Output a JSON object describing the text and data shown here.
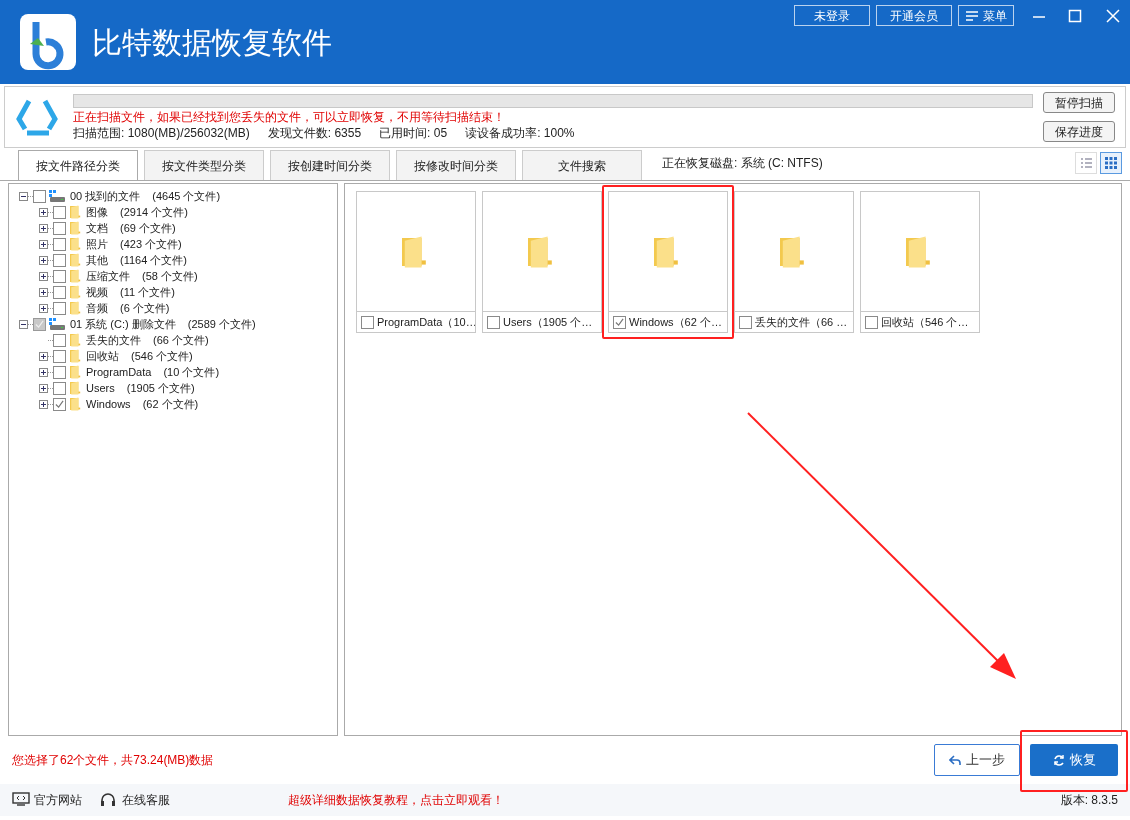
{
  "window": {
    "title": "比特数据恢复软件",
    "buttons": [
      {
        "kind": "text",
        "label": "未登录"
      },
      {
        "kind": "text",
        "label": "开通会员"
      },
      {
        "kind": "menu",
        "label": "菜单"
      }
    ]
  },
  "scan": {
    "level": 0,
    "message": "正在扫描文件，如果已经找到您丢失的文件，可以立即恢复，不用等待扫描结束！",
    "stats": [
      "扫描范围: 1080(MB)/256032(MB)",
      "发现文件数: 6355",
      "已用时间: 05",
      "读设备成功率: 100%"
    ],
    "buttons": [
      "暂停扫描",
      "保存进度"
    ]
  },
  "tabs": [
    {
      "label": "按文件路径分类",
      "selected": true
    },
    {
      "label": "按文件类型分类",
      "selected": false
    },
    {
      "label": "按创建时间分类",
      "selected": false
    },
    {
      "label": "按修改时间分类",
      "selected": false
    },
    {
      "label": "文件搜索",
      "selected": false
    }
  ],
  "disk_label": "正在恢复磁盘: 系统 (C: NTFS)",
  "view_modes": [
    {
      "kind": "list",
      "selected": false
    },
    {
      "kind": "grid",
      "selected": true
    }
  ],
  "tree": [
    {
      "label": "00 找到的文件",
      "count": "(4645 个文件)",
      "checked": false,
      "partial": false,
      "expanded": true,
      "children": [
        {
          "label": "图像",
          "count": "(2914 个文件)",
          "checked": false,
          "partial": false,
          "expanded": false
        },
        {
          "label": "文档",
          "count": "(69 个文件)",
          "checked": false,
          "partial": false,
          "expanded": false
        },
        {
          "label": "照片",
          "count": "(423 个文件)",
          "checked": false,
          "partial": false,
          "expanded": false
        },
        {
          "label": "其他",
          "count": "(1164 个文件)",
          "checked": false,
          "partial": false,
          "expanded": false
        },
        {
          "label": "压缩文件",
          "count": "(58 个文件)",
          "checked": false,
          "partial": false,
          "expanded": false
        },
        {
          "label": "视频",
          "count": "(11 个文件)",
          "checked": false,
          "partial": false,
          "expanded": false
        },
        {
          "label": "音频",
          "count": "(6 个文件)",
          "checked": false,
          "partial": false,
          "expanded": false
        }
      ]
    },
    {
      "label": "01 系统 (C:) 删除文件",
      "count": "(2589 个文件)",
      "checked": true,
      "partial": true,
      "expanded": true,
      "children": [
        {
          "label": "丢失的文件",
          "count": "(66 个文件)",
          "checked": false
        },
        {
          "label": "回收站",
          "count": "(546 个文件)",
          "checked": false,
          "partial": false,
          "expanded": false
        },
        {
          "label": "ProgramData",
          "count": "(10 个文件)",
          "checked": false,
          "partial": false,
          "expanded": false
        },
        {
          "label": "Users",
          "count": "(1905 个文件)",
          "checked": false,
          "partial": false,
          "expanded": false
        },
        {
          "label": "Windows",
          "count": "(62 个文件)",
          "checked": true,
          "expanded": false
        }
      ]
    }
  ],
  "tiles": [
    {
      "label": "ProgramData（10…",
      "checked": false,
      "highlighted": false
    },
    {
      "label": "Users（1905 个…",
      "checked": false,
      "highlighted": false
    },
    {
      "label": "Windows（62 个…",
      "checked": true,
      "highlighted": true
    },
    {
      "label": "丢失的文件（66 …",
      "checked": false,
      "highlighted": false
    },
    {
      "label": "回收站（546 个…",
      "checked": false,
      "highlighted": false
    }
  ],
  "selection_summary": "您选择了62个文件，共73.24(MB)数据",
  "actions": [
    {
      "kind": "back",
      "label": "上一步",
      "highlighted": false
    },
    {
      "kind": "recover",
      "label": "恢复",
      "highlighted": true
    }
  ],
  "footer": {
    "links": [
      {
        "kind": "site",
        "label": "官方网站"
      },
      {
        "kind": "support",
        "label": "在线客服"
      }
    ],
    "tutorial": "超级详细数据恢复教程，点击立即观看！",
    "version": "版本: 8.3.5"
  }
}
